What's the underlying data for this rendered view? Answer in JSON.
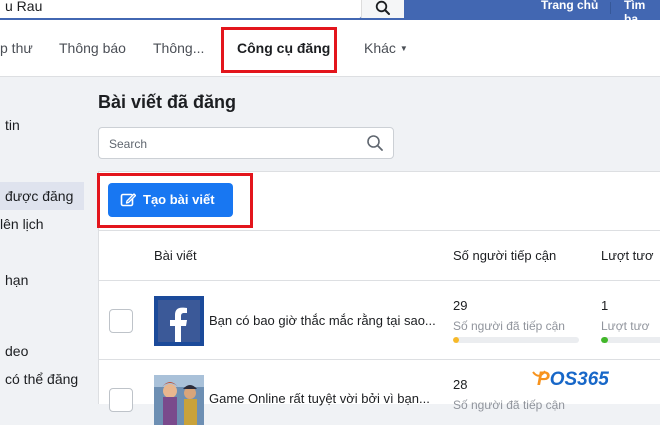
{
  "topbar": {
    "search_value": "u Rau",
    "links": [
      "Trang chủ",
      "Tìm bạ"
    ]
  },
  "nav": {
    "tabs": [
      "p thư",
      "Thông báo",
      "Thông...",
      "Công cụ đăng",
      "Khác"
    ]
  },
  "sidebar": {
    "items": [
      "tin",
      "được đăng",
      "lên lịch",
      "hạn",
      "deo",
      "có thể đăng"
    ]
  },
  "main": {
    "title": "Bài viết đã đăng",
    "search_placeholder": "Search",
    "create_button": "Tạo bài viết",
    "columns": [
      "Bài viết",
      "Số người tiếp cận",
      "Lượt tươ"
    ]
  },
  "posts": [
    {
      "text": "Bạn có bao giờ thắc mắc rằng tại sao...",
      "reach": "29",
      "reach_label": "Số người đã tiếp cận",
      "reach_bar": 0.05,
      "engagement": "1",
      "engagement_label": "Lượt tươ",
      "engagement_bar": 0.12,
      "thumb_icon": "facebook-logo-icon"
    },
    {
      "text": "Game Online rất tuyệt vời bởi vì bạn...",
      "reach": "28",
      "reach_label": "Số người đã tiếp cận",
      "thumb_icon": "game-character-icon"
    }
  ],
  "watermark": {
    "prefix": "P",
    "text": "OS365"
  },
  "colors": {
    "brand_blue": "#4267b2",
    "button_blue": "#1877f2",
    "highlight_red": "#e3151c",
    "reach_bar": "#f7b928",
    "engagement_bar": "#42b72a"
  }
}
